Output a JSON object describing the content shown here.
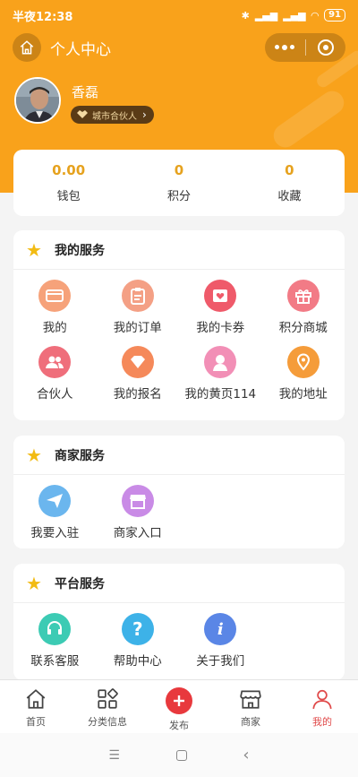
{
  "status_bar": {
    "time": "半夜12:38",
    "battery": "91"
  },
  "header": {
    "title": "个人中心"
  },
  "profile": {
    "name": "香磊",
    "badge": "城市合伙人"
  },
  "stats": [
    {
      "value": "0.00",
      "label": "钱包"
    },
    {
      "value": "0",
      "label": "积分"
    },
    {
      "value": "0",
      "label": "收藏"
    }
  ],
  "sections": {
    "my": {
      "title": "我的服务",
      "items": [
        {
          "label": "我的",
          "icon": "card-icon",
          "color": "#f6a27a"
        },
        {
          "label": "我的订单",
          "icon": "clipboard-icon",
          "color": "#f4a085"
        },
        {
          "label": "我的卡券",
          "icon": "coupon-icon",
          "color": "#ef5a6a"
        },
        {
          "label": "积分商城",
          "icon": "gift-icon",
          "color": "#f27b86"
        },
        {
          "label": "合伙人",
          "icon": "partners-icon",
          "color": "#ef6e7b"
        },
        {
          "label": "我的报名",
          "icon": "diamond-icon",
          "color": "#f5895a"
        },
        {
          "label": "我的黄页114",
          "icon": "person-icon",
          "color": "#f28fb6"
        },
        {
          "label": "我的地址",
          "icon": "location-icon",
          "color": "#f59c3a"
        }
      ]
    },
    "merchant": {
      "title": "商家服务",
      "items": [
        {
          "label": "我要入驻",
          "icon": "send-icon",
          "color": "#6bb6ee"
        },
        {
          "label": "商家入口",
          "icon": "store-icon",
          "color": "#c98be6"
        }
      ]
    },
    "platform": {
      "title": "平台服务",
      "items": [
        {
          "label": "联系客服",
          "icon": "headset-icon",
          "color": "#3ccbb4"
        },
        {
          "label": "帮助中心",
          "icon": "help-icon",
          "color": "#3db2e8"
        },
        {
          "label": "关于我们",
          "icon": "info-icon",
          "color": "#5a86e6"
        }
      ]
    }
  },
  "tabbar": [
    {
      "label": "首页",
      "icon": "home-icon"
    },
    {
      "label": "分类信息",
      "icon": "category-icon"
    },
    {
      "label": "发布",
      "icon": "plus-icon"
    },
    {
      "label": "商家",
      "icon": "shop-icon"
    },
    {
      "label": "我的",
      "icon": "profile-icon",
      "active": true
    }
  ],
  "colors": {
    "brand": "#f9a21b",
    "accent_text": "#e6a21e",
    "active_tab": "#e04a4a"
  }
}
